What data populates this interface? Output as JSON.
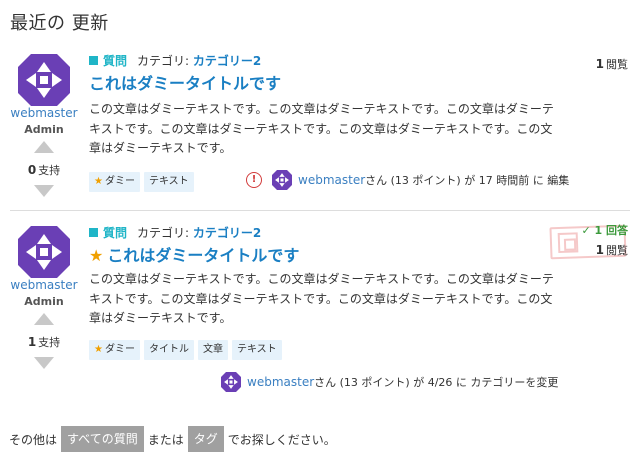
{
  "page_title": "最近の 更新",
  "questions": [
    {
      "user": "webmaster",
      "role": "Admin",
      "votes": "0",
      "votes_label": "支持",
      "type": "質問",
      "category_label": "カテゴリ:",
      "category": "カテゴリー2",
      "title": "これはダミータイトルです",
      "starred": false,
      "excerpt": "この文章はダミーテキストです。この文章はダミーテキストです。この文章はダミーテキストです。この文章はダミーテキストです。この文章はダミーテキストです。この文章はダミーテキストです。",
      "tags": [
        "ダミー",
        "テキスト"
      ],
      "views": "1",
      "views_label": "閲覧",
      "activity_user": "webmaster",
      "activity_text": "さん (13 ポイント) が 17 時間前 に 編集",
      "flag_symbol": "!"
    },
    {
      "user": "webmaster",
      "role": "Admin",
      "votes": "1",
      "votes_label": "支持",
      "type": "質問",
      "category_label": "カテゴリ:",
      "category": "カテゴリー2",
      "title": "これはダミータイトルです",
      "starred": true,
      "excerpt": "この文章はダミーテキストです。この文章はダミーテキストです。この文章はダミーテキストです。この文章はダミーテキストです。この文章はダミーテキストです。この文章はダミーテキストです。",
      "tags": [
        "ダミー",
        "タイトル",
        "文章",
        "テキスト"
      ],
      "answers": "✓ 1 回答",
      "views": "1",
      "views_label": "閲覧",
      "activity_user": "webmaster",
      "activity_text": "さん (13 ポイント) が 4/26 に カテゴリーを変更"
    }
  ],
  "footer": {
    "prefix": "その他は",
    "all_questions": "すべての質問",
    "or": "または",
    "tags": "タグ",
    "suffix": "でお探しください。"
  },
  "colors": {
    "link": "#1a7fc3",
    "accent": "#1fb5c7",
    "avatar": "#6a3fb5",
    "answered": "#3c9a3c",
    "star": "#f0a000"
  }
}
